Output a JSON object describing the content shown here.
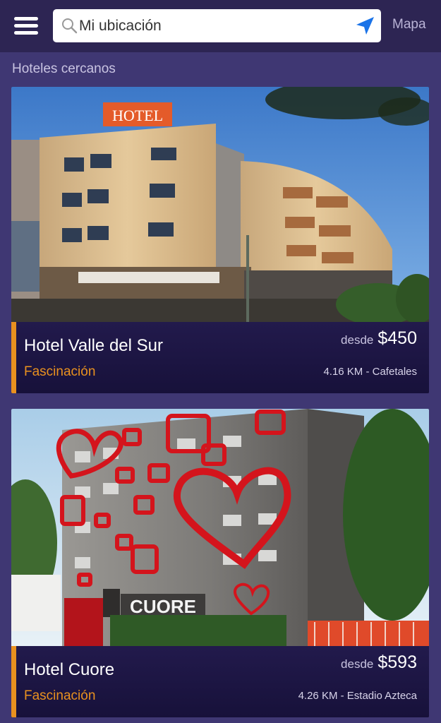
{
  "header": {
    "search_value": "Mi ubicación",
    "map_label": "Mapa"
  },
  "section_title": "Hoteles cercanos",
  "hotels": [
    {
      "name": "Hotel Valle del Sur",
      "category": "Fascinación",
      "price_prefix": "desde",
      "price": "$450",
      "distance": "4.16 KM - Cafetales",
      "sign_text": "HOTEL"
    },
    {
      "name": "Hotel Cuore",
      "category": "Fascinación",
      "price_prefix": "desde",
      "price": "$593",
      "distance": "4.26 KM - Estadio Azteca",
      "sign_text": "CUORE"
    }
  ],
  "colors": {
    "header_bg": "#2d2553",
    "page_bg": "#3f3773",
    "card_bg": "#1d1540",
    "accent": "#e9911f"
  }
}
